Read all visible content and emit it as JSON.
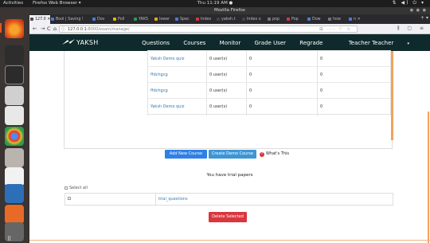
{
  "topbar": {
    "activities": "Activities",
    "app_menu": "Firefox Web Browser ▾",
    "clock": "Thu 11:19 AM ●",
    "tray": "⇅ ◀) ⏻ ▾"
  },
  "window": {
    "title": "Mozilla Firefox"
  },
  "tabs": [
    {
      "label": "127.0 ✕",
      "color": "#4a4a4f"
    },
    {
      "label": "Bool | Saving !",
      "color": "#4e7bd6"
    },
    {
      "label": "Dov",
      "color": "#4e7bd6"
    },
    {
      "label": "Poll",
      "color": "#e8b400"
    },
    {
      "label": "YAKS",
      "color": "#2e9b4b"
    },
    {
      "label": "lower",
      "color": "#f5a623"
    },
    {
      "label": "Spec",
      "color": "#4e7bd6"
    },
    {
      "label": "Index",
      "color": "#d9363e"
    },
    {
      "label": "yaksh.t",
      "color": "#444"
    },
    {
      "label": "Index o",
      "color": "#444"
    },
    {
      "label": "pop",
      "color": "#777"
    },
    {
      "label": "Pop",
      "color": "#d9363e"
    },
    {
      "label": "Dow",
      "color": "#4e7bd6"
    },
    {
      "label": "how",
      "color": "#777"
    },
    {
      "label": "n ✕",
      "color": "#4e7bd6"
    }
  ],
  "nav": {
    "back": "←",
    "forward": "→",
    "reload": "C",
    "home": "⌂",
    "url_host": "127.0.0.1:",
    "url_path": "8000/exam/manage/",
    "page_actions": "⊡ ··· ♡ ☆",
    "right_icons": "⫼ ▢ ≡"
  },
  "site": {
    "brand": "YAKSH",
    "links": [
      "Questions",
      "Courses",
      "Monitor",
      "Grade User",
      "Regrade",
      "Teacher Teacher"
    ],
    "caret": "▾"
  },
  "quiz_rows": [
    {
      "name": "Yaksh Demo quiz",
      "users": "0 user(s)",
      "col3": "0",
      "col4": "0"
    },
    {
      "name": "ffdchgcg",
      "users": "0 user(s)",
      "col3": "0",
      "col4": "0"
    },
    {
      "name": "ffdchgcg",
      "users": "0 user(s)",
      "col3": "0",
      "col4": "0"
    },
    {
      "name": "Yaksh Demo quiz",
      "users": "0 user(s)",
      "col3": "0",
      "col4": "0"
    }
  ],
  "actions": {
    "add_course": "Add New Course",
    "create_demo": "Create Demo Course",
    "whats_this": "What's This",
    "whats_icon": "?"
  },
  "trial": {
    "heading": "You have trial papers",
    "select_all": "Select all",
    "rows": [
      {
        "name": "trial_questions"
      }
    ],
    "delete": "Delete Selected"
  },
  "launcher": {
    "apps_grid": "⠿"
  },
  "colors": {
    "site_nav": "#0e2a2c",
    "add_button": "#2f80e7",
    "demo_button": "#3c96d6",
    "delete_button": "#d9363e",
    "link": "#337ab7"
  }
}
